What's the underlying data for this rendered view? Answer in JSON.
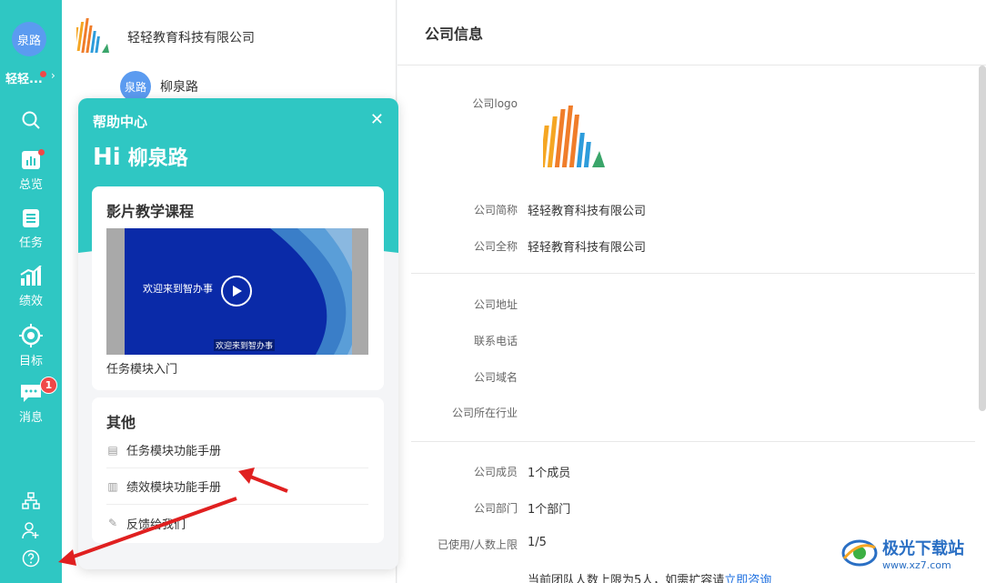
{
  "sidebar": {
    "avatar_text": "泉路",
    "workspace_name": "轻轻...",
    "items": [
      {
        "label": "",
        "icon": "search-icon"
      },
      {
        "label": "总览",
        "icon": "overview-icon"
      },
      {
        "label": "任务",
        "icon": "task-icon"
      },
      {
        "label": "绩效",
        "icon": "performance-icon"
      },
      {
        "label": "目标",
        "icon": "target-icon"
      },
      {
        "label": "消息",
        "icon": "message-icon",
        "badge": "1"
      }
    ],
    "bottom_icons": [
      "org-chart-icon",
      "add-member-icon",
      "help-icon"
    ]
  },
  "org": {
    "company_name": "轻轻教育科技有限公司",
    "member_avatar_text": "泉路",
    "member_name": "柳泉路"
  },
  "help": {
    "title": "帮助中心",
    "greeting": "Hi",
    "user_name": "柳泉路",
    "video_section_title": "影片教学课程",
    "video_caption": "欢迎来到智办事",
    "video_subtitle": "欢迎来到智办事",
    "video_label": "任务模块入门",
    "other_section_title": "其他",
    "other_items": [
      {
        "label": "任务模块功能手册",
        "icon": "document-icon"
      },
      {
        "label": "绩效模块功能手册",
        "icon": "chart-icon"
      },
      {
        "label": "反馈给我们",
        "icon": "pencil-icon"
      }
    ]
  },
  "main": {
    "title": "公司信息",
    "fields": [
      {
        "label": "公司logo",
        "value": ""
      },
      {
        "label": "公司简称",
        "value": "轻轻教育科技有限公司"
      },
      {
        "label": "公司全称",
        "value": "轻轻教育科技有限公司"
      },
      {
        "label": "公司地址",
        "value": ""
      },
      {
        "label": "联系电话",
        "value": ""
      },
      {
        "label": "公司域名",
        "value": ""
      },
      {
        "label": "公司所在行业",
        "value": ""
      },
      {
        "label": "公司成员",
        "value": "1个成员"
      },
      {
        "label": "公司部门",
        "value": "1个部门"
      },
      {
        "label": "已使用/人数上限",
        "value": "1/5"
      }
    ],
    "note_text": "当前团队人数上限为5人，如需扩容请",
    "note_link": "立即咨询"
  },
  "watermark": {
    "name": "极光下载站",
    "url": "www.xz7.com"
  },
  "colors": {
    "brand": "#2fc7c3",
    "avatar": "#5b9bf0",
    "badge": "#f04848",
    "link": "#1d6fe0"
  }
}
